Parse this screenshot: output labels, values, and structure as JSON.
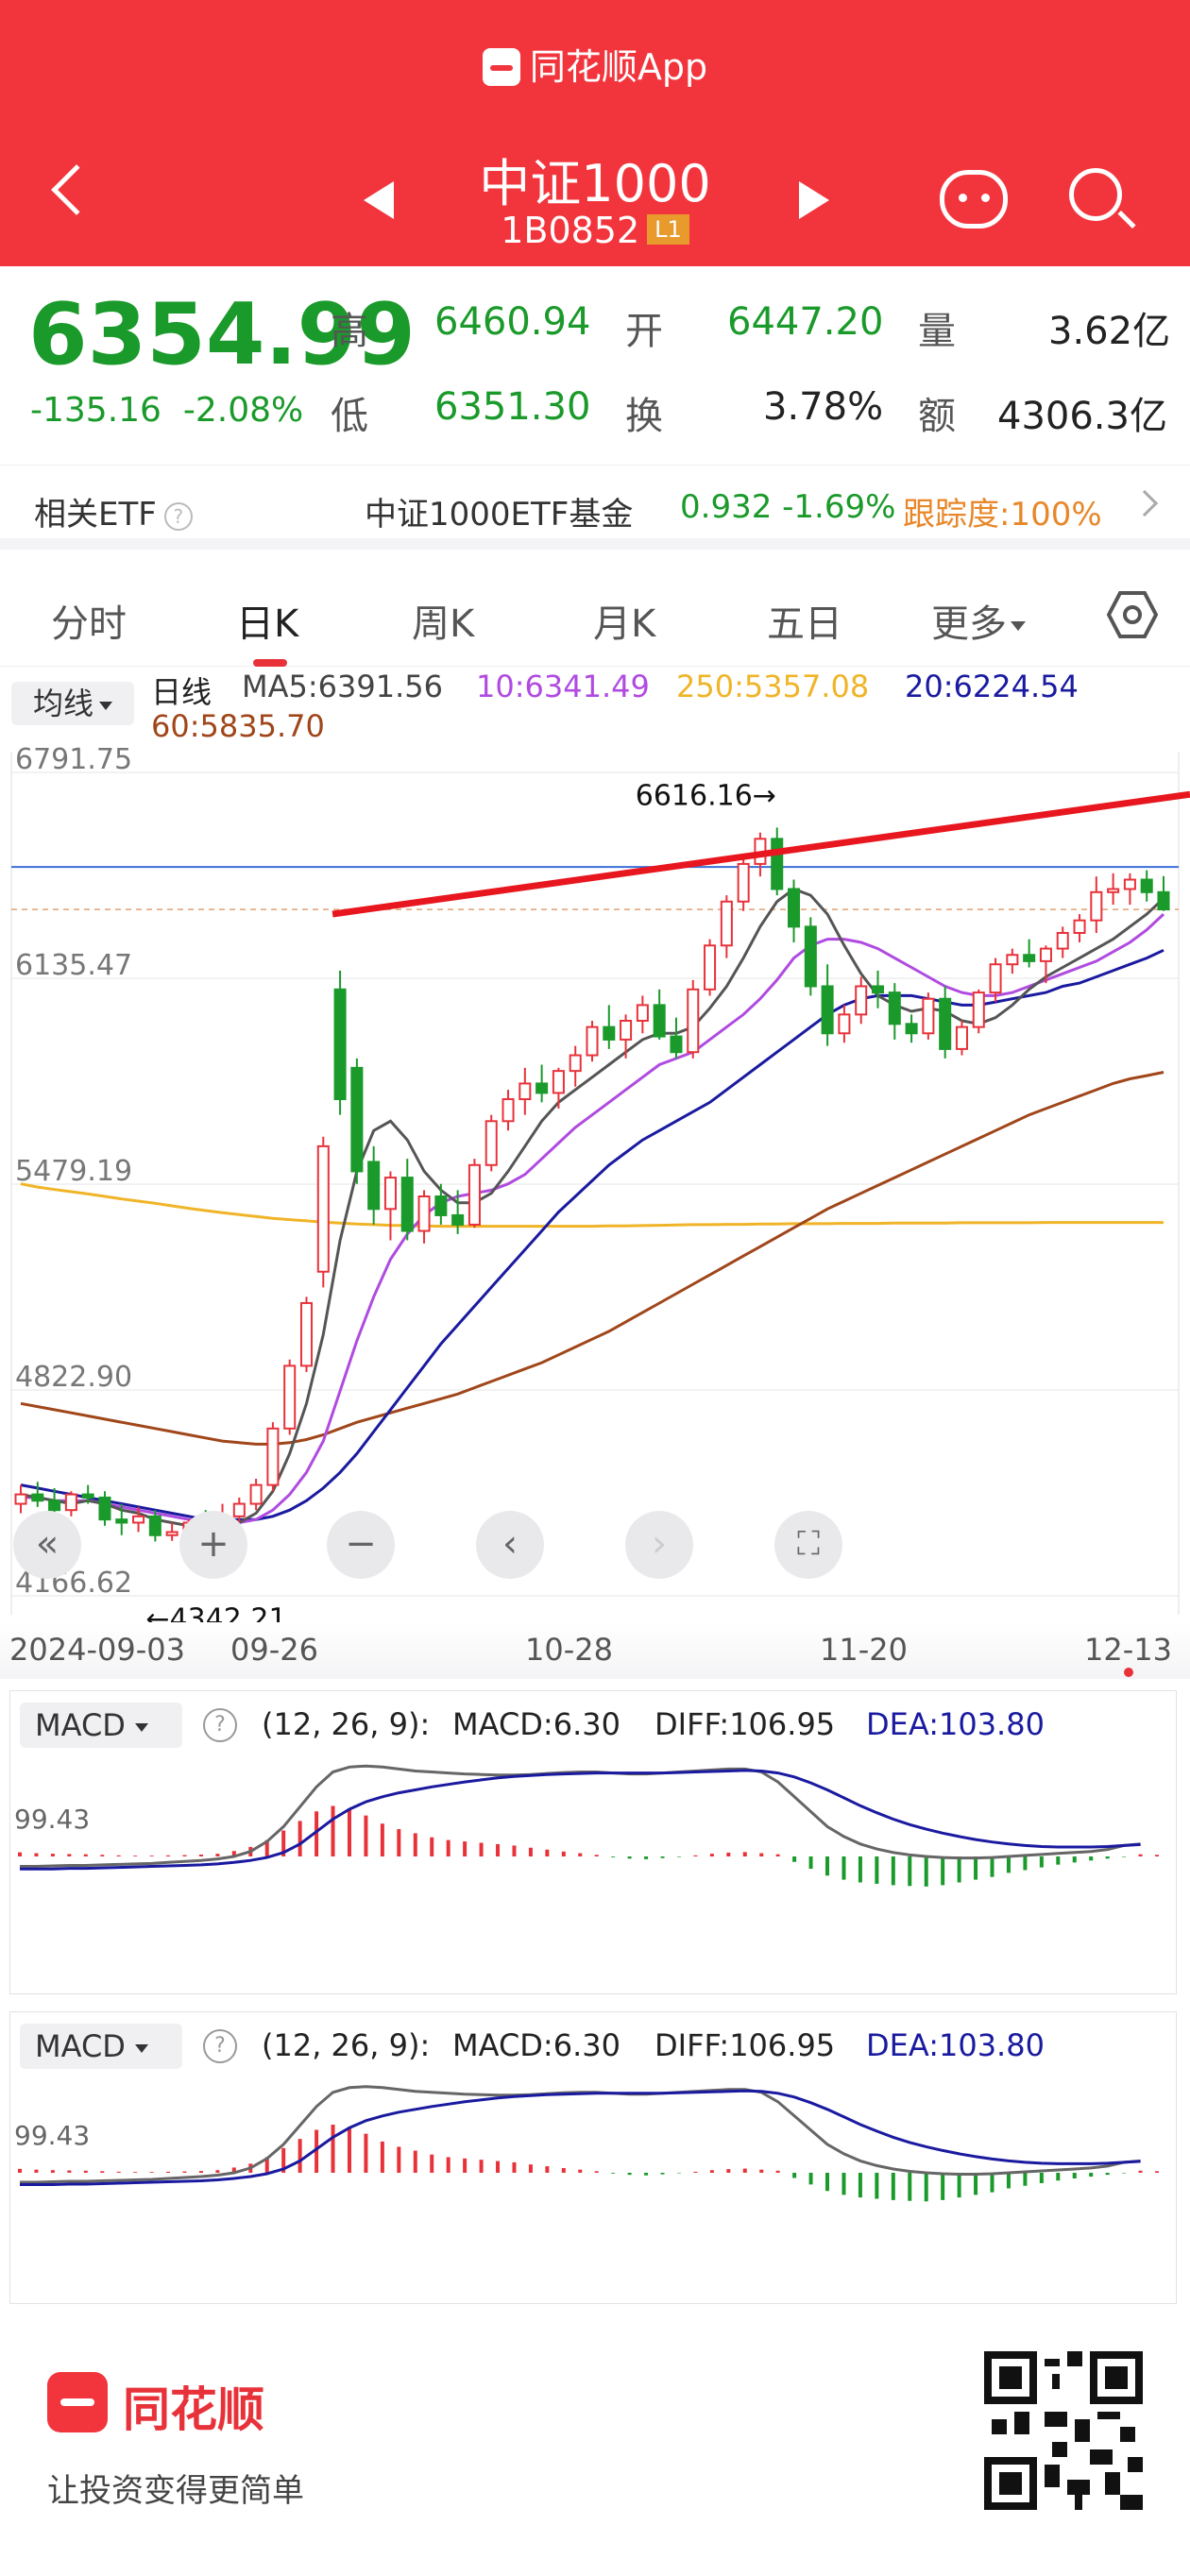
{
  "app": {
    "name": "同花顺App"
  },
  "header": {
    "title": "中证1000",
    "code": "1B0852",
    "level_badge": "L1"
  },
  "quote": {
    "price": "6354.99",
    "change": "-135.16",
    "change_pct": "-2.08%",
    "high_label": "高",
    "high": "6460.94",
    "open_label": "开",
    "open": "6447.20",
    "volume_label": "量",
    "volume": "3.62亿",
    "low_label": "低",
    "low": "6351.30",
    "turnover_label": "换",
    "turnover": "3.78%",
    "amount_label": "额",
    "amount": "4306.3亿"
  },
  "etf": {
    "label": "相关ETF",
    "help": "?",
    "name": "中证1000ETF基金",
    "value": "0.932 -1.69%",
    "tracking": "跟踪度:100%"
  },
  "tabs": [
    {
      "label": "分时"
    },
    {
      "label": "日K"
    },
    {
      "label": "周K"
    },
    {
      "label": "月K"
    },
    {
      "label": "五日"
    },
    {
      "label": "更多"
    }
  ],
  "ma": {
    "button": "均线",
    "period": "日线",
    "ma5": "MA5:6391.56",
    "ma10": "10:6341.49",
    "ma250": "250:5357.08",
    "ma20": "20:6224.54",
    "ma60": "60:5835.70"
  },
  "colors": {
    "up": "#e8323a",
    "down": "#1a9a2a",
    "ma5": "#555555",
    "ma10": "#b04be0",
    "ma20": "#1a1aa0",
    "ma60": "#a0461a",
    "ma250": "#f0b428",
    "accent": "#f2353d"
  },
  "chart_data": {
    "type": "candlestick",
    "y_axis_labels": [
      "6791.75",
      "6135.47",
      "5479.19",
      "4822.90",
      "4166.62"
    ],
    "ylim": [
      4166.62,
      6791.75
    ],
    "x_axis_labels": [
      "2024-09-03",
      "09-26",
      "10-28",
      "11-20",
      "12-13"
    ],
    "annotations": {
      "high": "6616.16→",
      "low": "←4342.21"
    },
    "candles": [
      [
        4460,
        4520,
        4430,
        4490
      ],
      [
        4490,
        4530,
        4450,
        4470
      ],
      [
        4470,
        4510,
        4420,
        4440
      ],
      [
        4440,
        4500,
        4420,
        4490
      ],
      [
        4490,
        4520,
        4460,
        4480
      ],
      [
        4480,
        4500,
        4390,
        4410
      ],
      [
        4410,
        4460,
        4360,
        4400
      ],
      [
        4400,
        4450,
        4370,
        4420
      ],
      [
        4420,
        4440,
        4340,
        4360
      ],
      [
        4360,
        4400,
        4342,
        4370
      ],
      [
        4370,
        4410,
        4350,
        4400
      ],
      [
        4400,
        4440,
        4360,
        4380
      ],
      [
        4380,
        4460,
        4370,
        4420
      ],
      [
        4420,
        4480,
        4400,
        4460
      ],
      [
        4460,
        4540,
        4440,
        4520
      ],
      [
        4520,
        4720,
        4500,
        4700
      ],
      [
        4700,
        4920,
        4680,
        4900
      ],
      [
        4900,
        5120,
        4880,
        5100
      ],
      [
        5200,
        5630,
        5150,
        5600
      ],
      [
        6100,
        6160,
        5700,
        5750
      ],
      [
        5850,
        5880,
        5480,
        5520
      ],
      [
        5550,
        5600,
        5350,
        5400
      ],
      [
        5400,
        5520,
        5300,
        5500
      ],
      [
        5500,
        5560,
        5300,
        5330
      ],
      [
        5330,
        5460,
        5290,
        5440
      ],
      [
        5440,
        5480,
        5350,
        5380
      ],
      [
        5380,
        5460,
        5320,
        5350
      ],
      [
        5350,
        5560,
        5340,
        5540
      ],
      [
        5540,
        5700,
        5520,
        5680
      ],
      [
        5680,
        5780,
        5650,
        5750
      ],
      [
        5750,
        5850,
        5700,
        5800
      ],
      [
        5800,
        5860,
        5740,
        5770
      ],
      [
        5770,
        5850,
        5720,
        5840
      ],
      [
        5840,
        5920,
        5790,
        5890
      ],
      [
        5890,
        6000,
        5870,
        5980
      ],
      [
        5980,
        6050,
        5910,
        5940
      ],
      [
        5940,
        6020,
        5880,
        6000
      ],
      [
        6000,
        6080,
        5960,
        6050
      ],
      [
        6050,
        6100,
        5940,
        5950
      ],
      [
        5950,
        6010,
        5880,
        5900
      ],
      [
        5900,
        6130,
        5880,
        6100
      ],
      [
        6100,
        6260,
        6080,
        6240
      ],
      [
        6240,
        6400,
        6200,
        6380
      ],
      [
        6380,
        6520,
        6350,
        6500
      ],
      [
        6500,
        6600,
        6460,
        6580
      ],
      [
        6580,
        6616,
        6400,
        6420
      ],
      [
        6420,
        6450,
        6250,
        6300
      ],
      [
        6300,
        6330,
        6080,
        6110
      ],
      [
        6110,
        6180,
        5920,
        5960
      ],
      [
        5960,
        6050,
        5930,
        6020
      ],
      [
        6020,
        6140,
        5990,
        6110
      ],
      [
        6110,
        6160,
        6040,
        6090
      ],
      [
        6090,
        6120,
        5940,
        5990
      ],
      [
        5990,
        6020,
        5930,
        5960
      ],
      [
        5960,
        6090,
        5940,
        6070
      ],
      [
        6070,
        6110,
        5880,
        5910
      ],
      [
        5910,
        6000,
        5890,
        5980
      ],
      [
        5980,
        6100,
        5960,
        6090
      ],
      [
        6090,
        6200,
        6060,
        6180
      ],
      [
        6180,
        6230,
        6150,
        6210
      ],
      [
        6210,
        6260,
        6170,
        6190
      ],
      [
        6190,
        6240,
        6120,
        6230
      ],
      [
        6230,
        6300,
        6200,
        6280
      ],
      [
        6280,
        6340,
        6250,
        6320
      ],
      [
        6320,
        6460,
        6280,
        6410
      ],
      [
        6410,
        6470,
        6370,
        6420
      ],
      [
        6420,
        6470,
        6370,
        6450
      ],
      [
        6450,
        6480,
        6380,
        6410
      ],
      [
        6410,
        6461,
        6350,
        6355
      ]
    ],
    "ma_lines": {
      "ma5": [
        4490,
        4480,
        4470,
        4460,
        4470,
        4460,
        4440,
        4430,
        4410,
        4400,
        4390,
        4390,
        4390,
        4400,
        4430,
        4500,
        4620,
        4780,
        5000,
        5300,
        5520,
        5650,
        5680,
        5620,
        5520,
        5460,
        5420,
        5420,
        5450,
        5520,
        5600,
        5680,
        5740,
        5780,
        5820,
        5860,
        5900,
        5940,
        5960,
        5960,
        5980,
        6040,
        6110,
        6200,
        6300,
        6380,
        6420,
        6400,
        6340,
        6240,
        6150,
        6080,
        6050,
        6030,
        6040,
        6030,
        6000,
        5990,
        6010,
        6050,
        6100,
        6140,
        6170,
        6200,
        6230,
        6260,
        6300,
        6340,
        6390
      ],
      "ma10": [
        4480,
        4480,
        4470,
        4470,
        4470,
        4460,
        4450,
        4440,
        4430,
        4420,
        4410,
        4400,
        4400,
        4400,
        4410,
        4440,
        4490,
        4560,
        4660,
        4820,
        4980,
        5120,
        5240,
        5320,
        5380,
        5420,
        5440,
        5450,
        5460,
        5480,
        5510,
        5560,
        5610,
        5660,
        5700,
        5740,
        5780,
        5820,
        5860,
        5880,
        5900,
        5940,
        5980,
        6020,
        6070,
        6130,
        6200,
        6240,
        6260,
        6260,
        6250,
        6230,
        6200,
        6170,
        6140,
        6110,
        6090,
        6080,
        6080,
        6090,
        6110,
        6130,
        6150,
        6170,
        6190,
        6220,
        6250,
        6290,
        6340
      ],
      "ma20": [
        4520,
        4510,
        4500,
        4490,
        4480,
        4470,
        4460,
        4450,
        4440,
        4430,
        4420,
        4410,
        4410,
        4410,
        4410,
        4420,
        4440,
        4470,
        4510,
        4560,
        4620,
        4690,
        4760,
        4830,
        4900,
        4970,
        5030,
        5090,
        5150,
        5210,
        5270,
        5330,
        5390,
        5440,
        5490,
        5540,
        5580,
        5620,
        5650,
        5680,
        5710,
        5740,
        5780,
        5820,
        5860,
        5900,
        5940,
        5980,
        6020,
        6050,
        6070,
        6080,
        6080,
        6080,
        6070,
        6060,
        6050,
        6050,
        6060,
        6070,
        6080,
        6090,
        6110,
        6120,
        6140,
        6160,
        6180,
        6200,
        6225
      ],
      "ma60": [
        4780,
        4770,
        4760,
        4750,
        4740,
        4730,
        4720,
        4710,
        4700,
        4690,
        4680,
        4670,
        4660,
        4655,
        4650,
        4650,
        4655,
        4665,
        4680,
        4700,
        4720,
        4735,
        4750,
        4765,
        4780,
        4795,
        4810,
        4830,
        4850,
        4870,
        4890,
        4910,
        4935,
        4960,
        4985,
        5010,
        5040,
        5070,
        5100,
        5130,
        5160,
        5190,
        5220,
        5250,
        5280,
        5310,
        5340,
        5370,
        5400,
        5425,
        5450,
        5475,
        5500,
        5525,
        5550,
        5575,
        5600,
        5625,
        5650,
        5675,
        5700,
        5720,
        5740,
        5760,
        5780,
        5800,
        5815,
        5825,
        5836
      ],
      "ma250": [
        5480,
        5470,
        5462,
        5455,
        5448,
        5440,
        5432,
        5425,
        5418,
        5410,
        5402,
        5395,
        5388,
        5382,
        5376,
        5370,
        5366,
        5362,
        5358,
        5355,
        5352,
        5350,
        5348,
        5347,
        5346,
        5345,
        5345,
        5345,
        5345,
        5345,
        5345,
        5345,
        5345,
        5345,
        5345,
        5346,
        5346,
        5347,
        5348,
        5349,
        5350,
        5350,
        5351,
        5351,
        5352,
        5352,
        5353,
        5353,
        5353,
        5354,
        5354,
        5354,
        5355,
        5355,
        5355,
        5355,
        5356,
        5356,
        5356,
        5356,
        5356,
        5357,
        5357,
        5357,
        5357,
        5357,
        5357,
        5357,
        5357
      ]
    }
  },
  "controls": {
    "left_double": "«",
    "zoom_in": "+",
    "zoom_out": "−",
    "prev": "‹",
    "next": "›",
    "fullscreen": "⛶"
  },
  "macd": {
    "button": "MACD",
    "help": "?",
    "params": "(12, 26, 9):",
    "macd": "MACD:6.30",
    "diff": "DIFF:106.95",
    "dea": "DEA:103.80",
    "axis_label": "99.43",
    "bars": [
      15,
      12,
      10,
      9,
      8,
      6,
      4,
      3,
      3,
      4,
      5,
      7,
      10,
      20,
      35,
      60,
      95,
      130,
      165,
      185,
      175,
      150,
      120,
      100,
      85,
      70,
      60,
      55,
      50,
      45,
      40,
      32,
      25,
      18,
      12,
      6,
      -3,
      -8,
      -10,
      -6,
      -2,
      4,
      10,
      14,
      16,
      12,
      8,
      -20,
      -45,
      -70,
      -85,
      -95,
      -100,
      -105,
      -108,
      -110,
      -105,
      -95,
      -85,
      -75,
      -60,
      -50,
      -40,
      -30,
      -22,
      -15,
      -8,
      -2,
      8,
      6
    ],
    "diff_line": [
      -20,
      -20,
      -19,
      -18,
      -18,
      -17,
      -16,
      -15,
      -14,
      -12,
      -10,
      -8,
      -5,
      0,
      10,
      30,
      60,
      100,
      140,
      170,
      180,
      182,
      180,
      176,
      172,
      170,
      168,
      166,
      165,
      164,
      164,
      165,
      167,
      169,
      170,
      170,
      168,
      166,
      166,
      168,
      170,
      172,
      174,
      176,
      176,
      170,
      150,
      120,
      90,
      60,
      40,
      25,
      15,
      8,
      3,
      0,
      -2,
      -3,
      -3,
      -2,
      0,
      2,
      4,
      6,
      8,
      10,
      14,
      22,
      25
    ],
    "dea_line": [
      -25,
      -25,
      -25,
      -24,
      -24,
      -23,
      -22,
      -21,
      -20,
      -19,
      -18,
      -17,
      -15,
      -12,
      -8,
      -2,
      8,
      25,
      50,
      75,
      95,
      110,
      120,
      128,
      134,
      140,
      145,
      150,
      154,
      158,
      161,
      163,
      165,
      166,
      167,
      168,
      168,
      168,
      168,
      168,
      169,
      170,
      171,
      172,
      173,
      172,
      168,
      160,
      148,
      134,
      118,
      102,
      88,
      75,
      64,
      55,
      47,
      40,
      34,
      29,
      25,
      22,
      20,
      19,
      19,
      19,
      20,
      22,
      24
    ]
  },
  "footer": {
    "brand": "同花顺",
    "slogan": "让投资变得更简单"
  }
}
